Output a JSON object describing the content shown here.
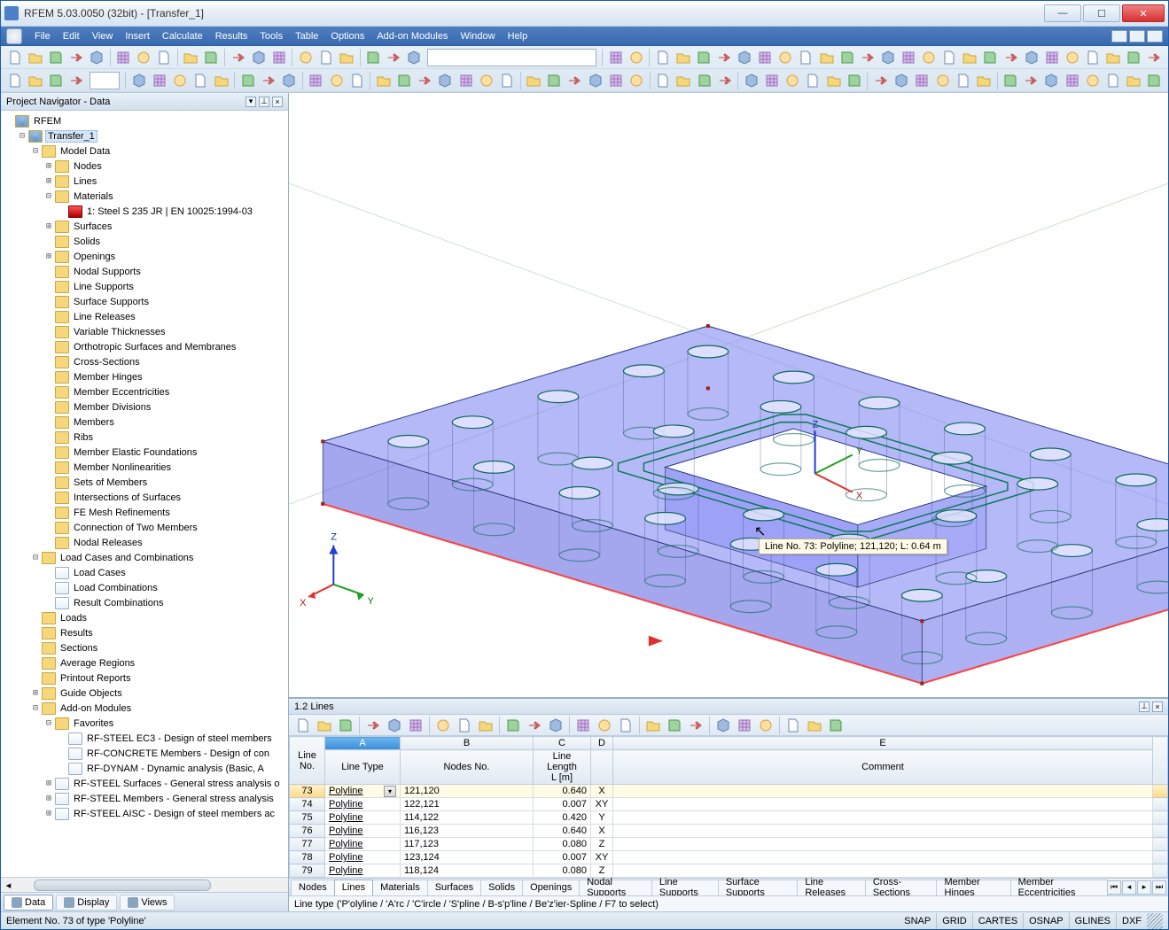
{
  "window": {
    "title": "RFEM 5.03.0050 (32bit) - [Transfer_1]"
  },
  "menus": [
    "File",
    "Edit",
    "View",
    "Insert",
    "Calculate",
    "Results",
    "Tools",
    "Table",
    "Options",
    "Add-on Modules",
    "Window",
    "Help"
  ],
  "navigator": {
    "title": "Project Navigator - Data",
    "root": "RFEM",
    "project": "Transfer_1",
    "modelData": "Model Data",
    "modelItems": [
      "Nodes",
      "Lines",
      "Materials"
    ],
    "material1": "1: Steel S 235 JR | EN 10025:1994-03",
    "modelItems2": [
      "Surfaces",
      "Solids",
      "Openings",
      "Nodal Supports",
      "Line Supports",
      "Surface Supports",
      "Line Releases",
      "Variable Thicknesses",
      "Orthotropic Surfaces and Membranes",
      "Cross-Sections",
      "Member Hinges",
      "Member Eccentricities",
      "Member Divisions",
      "Members",
      "Ribs",
      "Member Elastic Foundations",
      "Member Nonlinearities",
      "Sets of Members",
      "Intersections of Surfaces",
      "FE Mesh Refinements",
      "Connection of Two Members",
      "Nodal Releases"
    ],
    "loadCasesComb": "Load Cases and Combinations",
    "loadCasesItems": [
      "Load Cases",
      "Load Combinations",
      "Result Combinations"
    ],
    "topItems": [
      "Loads",
      "Results",
      "Sections",
      "Average Regions",
      "Printout Reports",
      "Guide Objects",
      "Add-on Modules"
    ],
    "favorites": "Favorites",
    "favItems": [
      "RF-STEEL EC3 - Design of steel members",
      "RF-CONCRETE Members - Design of con",
      "RF-DYNAM - Dynamic analysis (Basic, A"
    ],
    "addOns": [
      "RF-STEEL Surfaces - General stress analysis o",
      "RF-STEEL Members - General stress analysis",
      "RF-STEEL AISC - Design of steel members ac"
    ],
    "tabs": [
      "Data",
      "Display",
      "Views"
    ]
  },
  "viewport": {
    "tooltip": "Line No. 73: Polyline; 121,120; L: 0.64 m",
    "axes": {
      "x": "X",
      "y": "Y",
      "z": "Z"
    }
  },
  "table": {
    "title": "1.2 Lines",
    "colLetters": [
      "A",
      "B",
      "C",
      "D",
      "E"
    ],
    "headers": {
      "no": "Line\nNo.",
      "type": "Line Type",
      "nodes": "Nodes No.",
      "len": "Line Length\nL [m]",
      "blank": "",
      "comment": "Comment"
    },
    "rows": [
      {
        "no": "73",
        "type": "Polyline",
        "nodes": "121,120",
        "len": "0.640",
        "d": "X",
        "sel": true,
        "dd": true
      },
      {
        "no": "74",
        "type": "Polyline",
        "nodes": "122,121",
        "len": "0.007",
        "d": "XY"
      },
      {
        "no": "75",
        "type": "Polyline",
        "nodes": "114,122",
        "len": "0.420",
        "d": "Y"
      },
      {
        "no": "76",
        "type": "Polyline",
        "nodes": "116,123",
        "len": "0.640",
        "d": "X"
      },
      {
        "no": "77",
        "type": "Polyline",
        "nodes": "117,123",
        "len": "0.080",
        "d": "Z"
      },
      {
        "no": "78",
        "type": "Polyline",
        "nodes": "123,124",
        "len": "0.007",
        "d": "XY"
      },
      {
        "no": "79",
        "type": "Polyline",
        "nodes": "118,124",
        "len": "0.080",
        "d": "Z"
      }
    ],
    "tabs": [
      "Nodes",
      "Lines",
      "Materials",
      "Surfaces",
      "Solids",
      "Openings",
      "Nodal Supports",
      "Line Supports",
      "Surface Supports",
      "Line Releases",
      "Cross-Sections",
      "Member Hinges",
      "Member Eccentricities"
    ],
    "activeTab": 1
  },
  "infobar": "Line type ('P'olyline / 'A'rc / 'C'ircle / 'S'pline / B-s'p'line / Be'z'ier-Spline / F7 to select)",
  "status": {
    "left": "Element No. 73 of type 'Polyline'",
    "inds": [
      "SNAP",
      "GRID",
      "CARTES",
      "OSNAP",
      "GLINES",
      "DXF"
    ]
  }
}
